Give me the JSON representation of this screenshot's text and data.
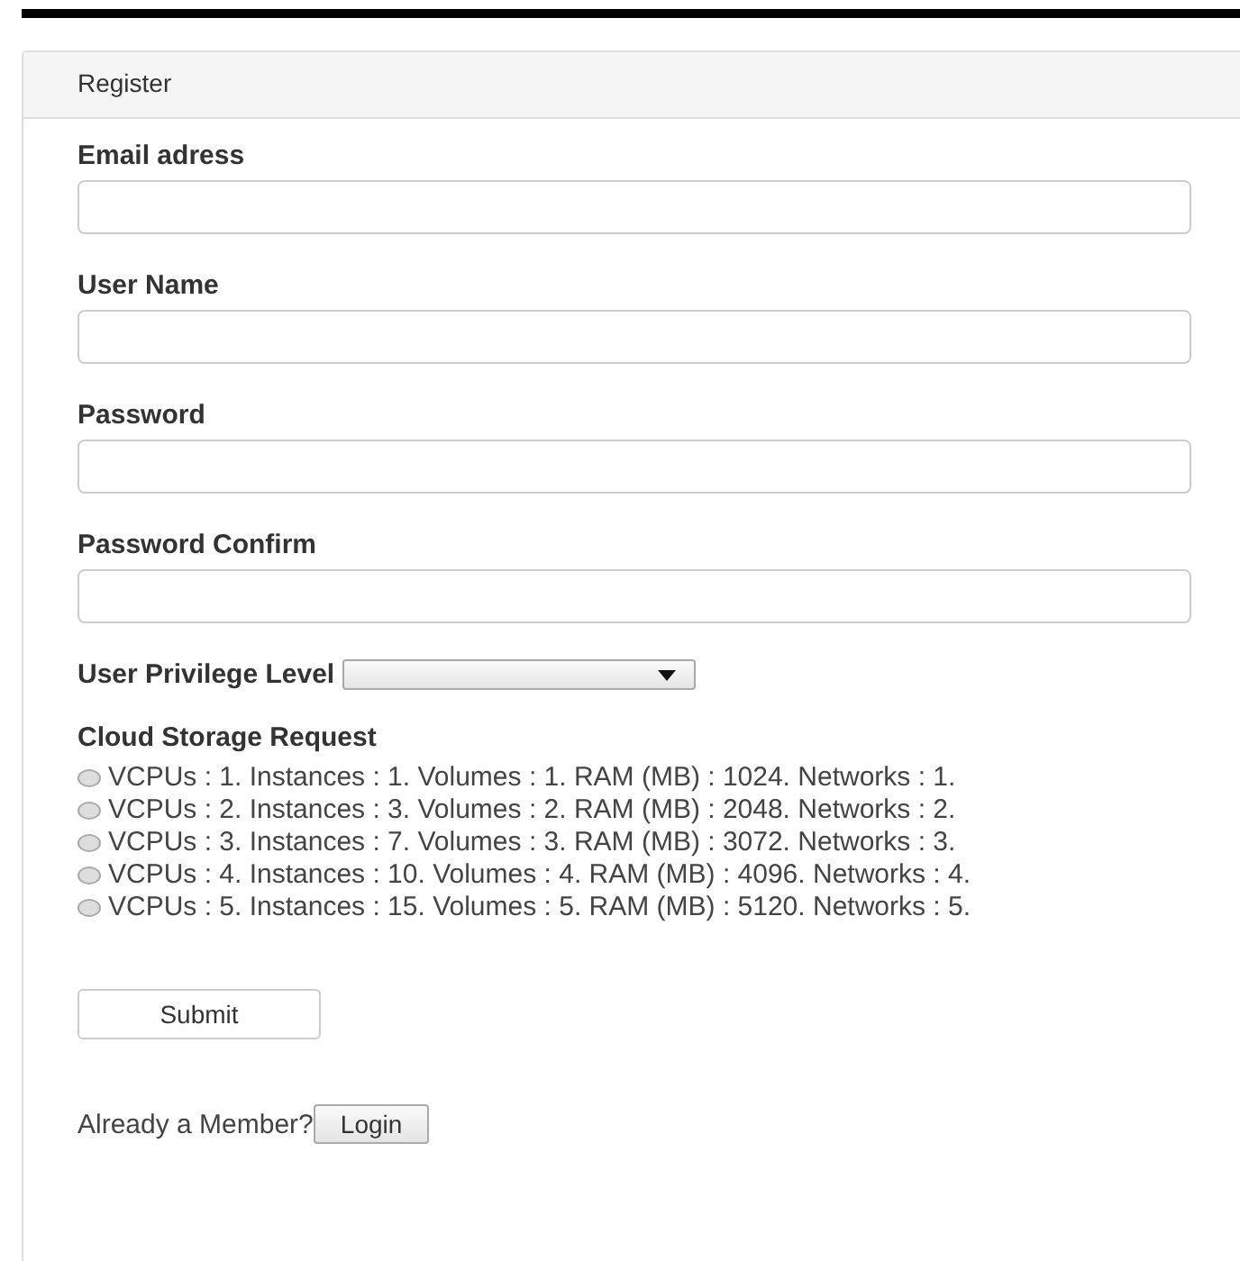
{
  "panel": {
    "title": "Register"
  },
  "fields": [
    {
      "label": "Email adress"
    },
    {
      "label": "User Name"
    },
    {
      "label": "Password"
    },
    {
      "label": "Password Confirm"
    }
  ],
  "privilege": {
    "label": "User Privilege Level"
  },
  "storage": {
    "label": "Cloud Storage Request",
    "options": [
      {
        "text": "VCPUs : 1. Instances : 1. Volumes : 1. RAM (MB) : 1024. Networks : 1.",
        "selected": false
      },
      {
        "text": "VCPUs : 2. Instances : 3. Volumes : 2. RAM (MB) : 2048. Networks : 2.",
        "selected": false
      },
      {
        "text": "VCPUs : 3. Instances : 7. Volumes : 3. RAM (MB) : 3072. Networks : 3.",
        "selected": false
      },
      {
        "text": "VCPUs : 4. Instances : 10. Volumes : 4. RAM (MB) : 4096. Networks : 4.",
        "selected": false
      },
      {
        "text": "VCPUs : 5. Instances : 15. Volumes : 5. RAM (MB) : 5120. Networks : 5.",
        "selected": false
      }
    ]
  },
  "submit": "Submit",
  "login": {
    "prompt": "Already a Member?",
    "button": "Login"
  }
}
